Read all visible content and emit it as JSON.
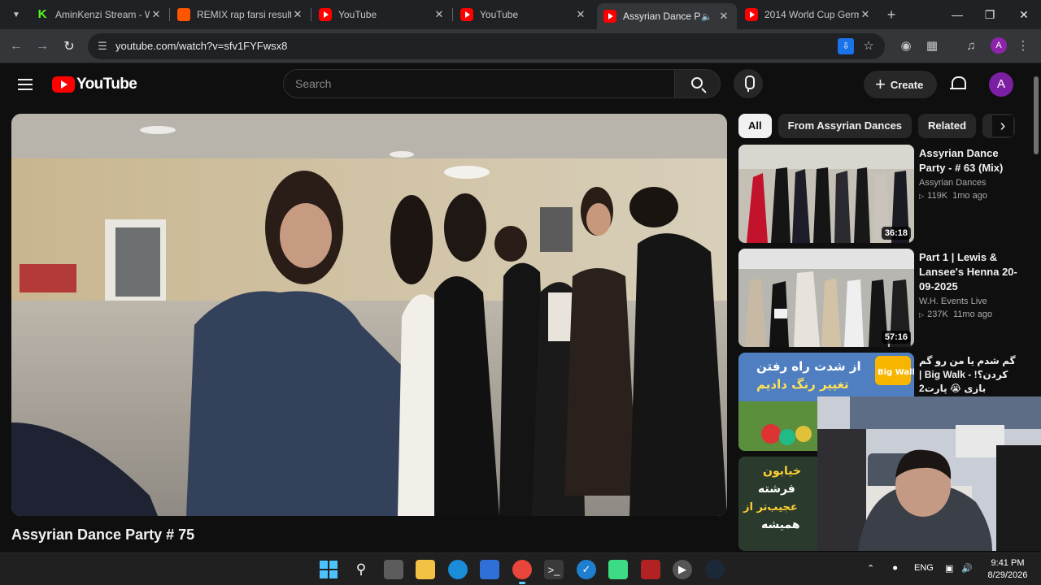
{
  "browser": {
    "tabs": [
      {
        "title": "AminKenzi Stream - W",
        "favicon": "kick-icon",
        "active": false
      },
      {
        "title": "REMIX rap farsi results",
        "favicon": "soundcloud-icon",
        "active": false
      },
      {
        "title": "YouTube",
        "favicon": "youtube-icon",
        "active": false
      },
      {
        "title": "YouTube",
        "favicon": "youtube-icon",
        "active": false
      },
      {
        "title": "Assyrian Dance Par",
        "favicon": "youtube-icon",
        "active": true,
        "audio": true
      },
      {
        "title": "2014 World Cup Germ",
        "favicon": "youtube-icon",
        "active": false
      }
    ],
    "url": "youtube.com/watch?v=sfv1FYFwsx8",
    "profile_initial": "A"
  },
  "youtube": {
    "logo_text": "YouTube",
    "search_placeholder": "Search",
    "create_label": "Create",
    "avatar_initial": "A",
    "video_title": "Assyrian Dance Party # 75",
    "chips": [
      "All",
      "From Assyrian Dances",
      "Related",
      "Fo"
    ],
    "recommendations": [
      {
        "title": "Assyrian Dance Party - # 63 (Mix)",
        "channel": "Assyrian Dances",
        "views": "119K",
        "age": "1mo ago",
        "duration": "36:18"
      },
      {
        "title": "Part 1 | Lewis & Lansee's Henna 20-09-2025",
        "channel": "W.H. Events Live",
        "views": "237K",
        "age": "11mo ago",
        "duration": "57:16"
      },
      {
        "title": "گم شدم یا من رو گم کردن؟! - Big Walk | بازی 😭 پارت2",
        "channel": "",
        "views": "",
        "age": "",
        "duration": ""
      },
      {
        "title": "",
        "channel": "",
        "views": "",
        "age": "",
        "duration": ""
      }
    ],
    "thumb_text": {
      "rec3_line1": "از شدت راه رفتن",
      "rec3_line2": "تغییر رنگ دادیم",
      "rec3_badge": "Big Walk",
      "rec4_line1": "خیابون",
      "rec4_line2": "فرشته",
      "rec4_line3": "عجیب‌تر از",
      "rec4_line4": "همیشه"
    }
  },
  "taskbar": {
    "language": "ENG",
    "time": "9:41 PM",
    "date": "8/29/2026"
  }
}
